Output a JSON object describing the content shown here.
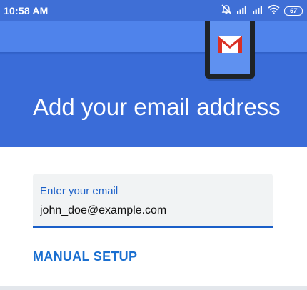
{
  "status_bar": {
    "time": "10:58 AM",
    "battery_level": "67",
    "icons": [
      "alarm-off-icon",
      "signal-icon",
      "signal-icon",
      "wifi-icon",
      "battery-icon"
    ]
  },
  "hero": {
    "title": "Add your email address",
    "illustration": "tablet-gmail-icon",
    "color": "#3a6cd8"
  },
  "form": {
    "email_label": "Enter your email",
    "email_value": "john_doe@example.com",
    "accent_color": "#1a5fc8"
  },
  "actions": {
    "manual_setup_label": "MANUAL SETUP"
  }
}
